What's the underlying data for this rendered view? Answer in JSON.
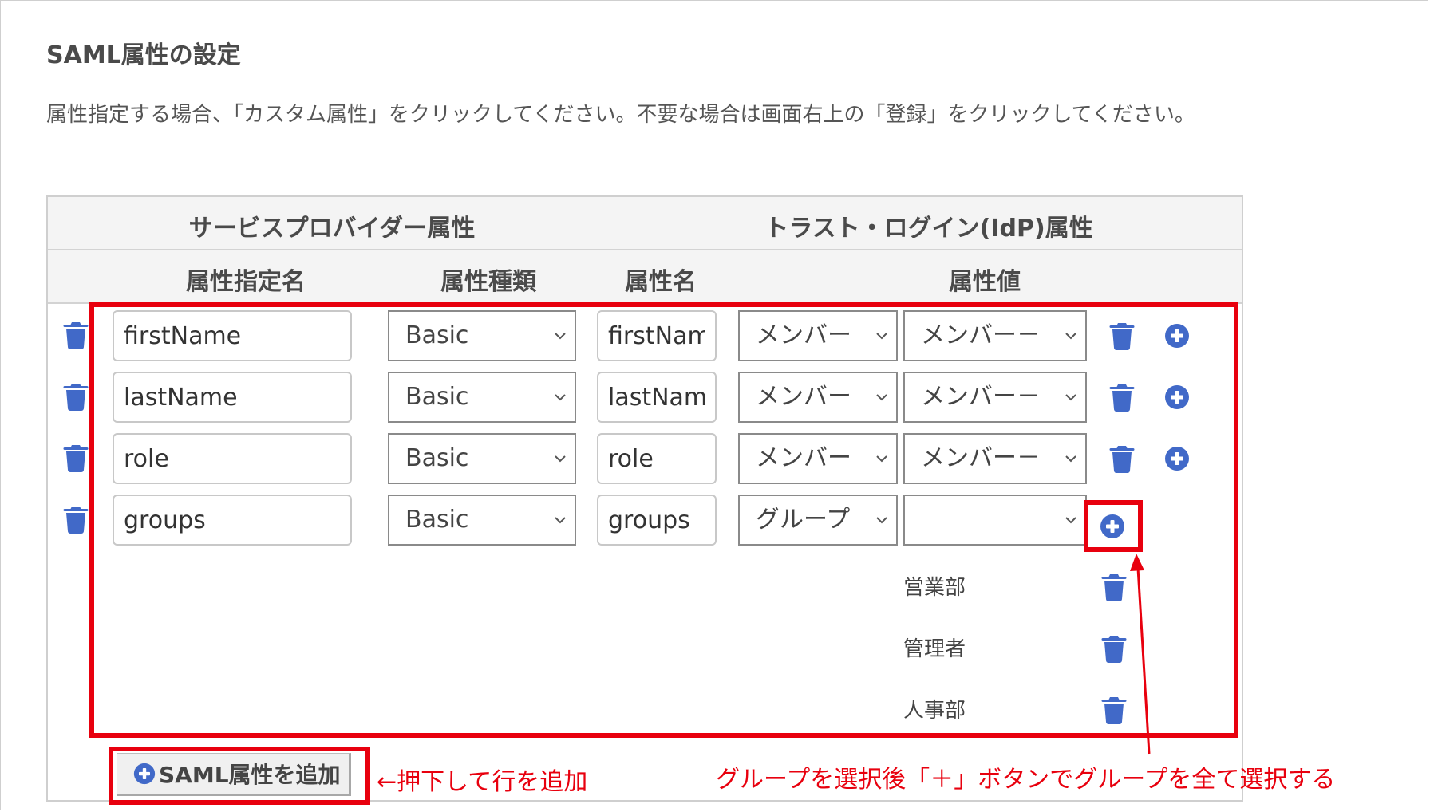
{
  "section": {
    "title": "SAML属性の設定",
    "description": "属性指定する場合、「カスタム属性」をクリックしてください。不要な場合は画面右上の「登録」をクリックしてください。"
  },
  "table": {
    "group_headers": {
      "sp": "サービスプロバイダー属性",
      "idp": "トラスト・ログイン(IdP)属性"
    },
    "columns": {
      "name": "属性指定名",
      "type": "属性種類",
      "attr_name": "属性名",
      "value": "属性値"
    },
    "rows": [
      {
        "name": "firstName",
        "type": "Basic",
        "attr_name": "firstNam",
        "value_select": "メンバー",
        "value_detail": "メンバー－"
      },
      {
        "name": "lastName",
        "type": "Basic",
        "attr_name": "lastNam",
        "value_select": "メンバー",
        "value_detail": "メンバー－"
      },
      {
        "name": "role",
        "type": "Basic",
        "attr_name": "role",
        "value_select": "メンバー",
        "value_detail": "メンバー－"
      },
      {
        "name": "groups",
        "type": "Basic",
        "attr_name": "groups",
        "value_select": "グループ",
        "value_detail": ""
      }
    ],
    "groups": [
      "営業部",
      "管理者",
      "人事部"
    ]
  },
  "add_button": {
    "label": "SAML属性を追加"
  },
  "annotations": {
    "add_row": "←押下して行を追加",
    "group_hint": "グループを選択後「＋」ボタンでグループを全て選択する"
  },
  "colors": {
    "icon_blue": "#4169c8",
    "annotation_red": "#e8000e"
  },
  "icons": {
    "delete": "trash-icon",
    "add": "plus-circle-icon",
    "dropdown": "chevron-down-icon"
  }
}
